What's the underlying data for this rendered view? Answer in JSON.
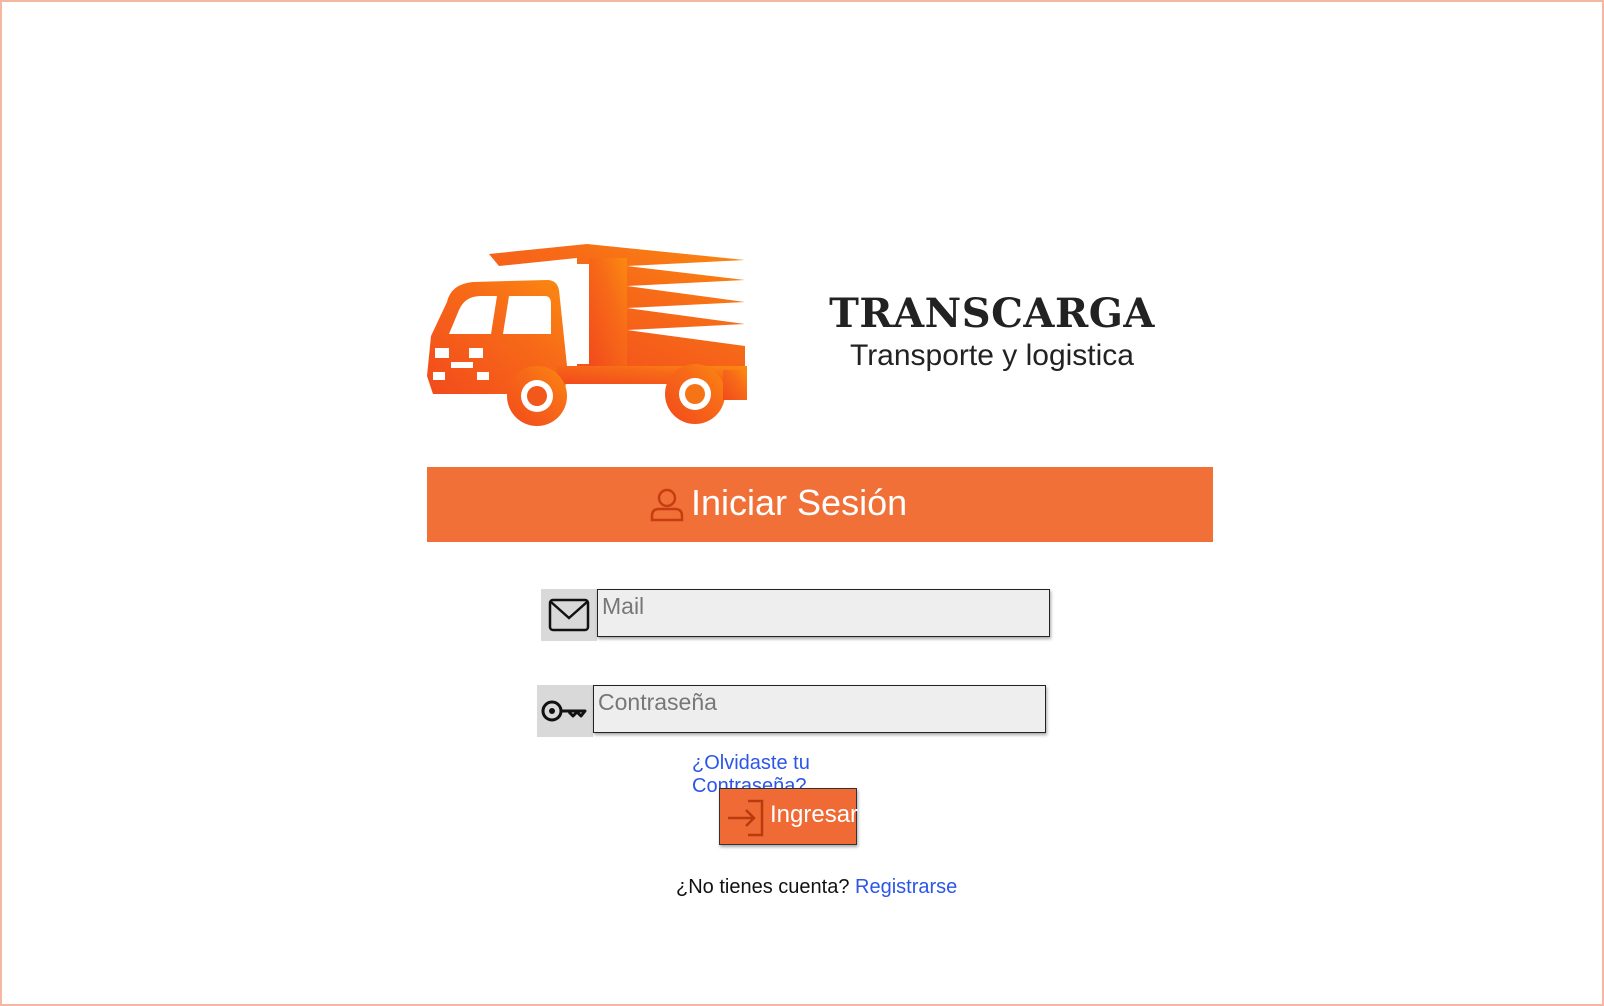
{
  "brand": {
    "name": "TRANSCARGA",
    "tagline": "Transporte y logistica",
    "logo_icon": "delivery-truck-icon"
  },
  "login": {
    "title": "Iniciar Sesión",
    "title_icon": "user-icon"
  },
  "form": {
    "mail": {
      "icon": "envelope-icon",
      "placeholder": "Mail",
      "value": ""
    },
    "password": {
      "icon": "key-icon",
      "placeholder": "Contraseña",
      "value": ""
    },
    "forgot_link": "¿Olvidaste tu Contraseña?",
    "submit": {
      "icon": "enter-icon",
      "label": "Ingresar"
    },
    "register_prompt": "¿No tienes cuenta?",
    "register_link": "Registrarse"
  },
  "colors": {
    "accent": "#f07038",
    "link": "#2c56e8",
    "page_border": "#f3b7a2",
    "input_bg": "#eeeeee",
    "icon_box_bg": "#d9d9d9"
  }
}
